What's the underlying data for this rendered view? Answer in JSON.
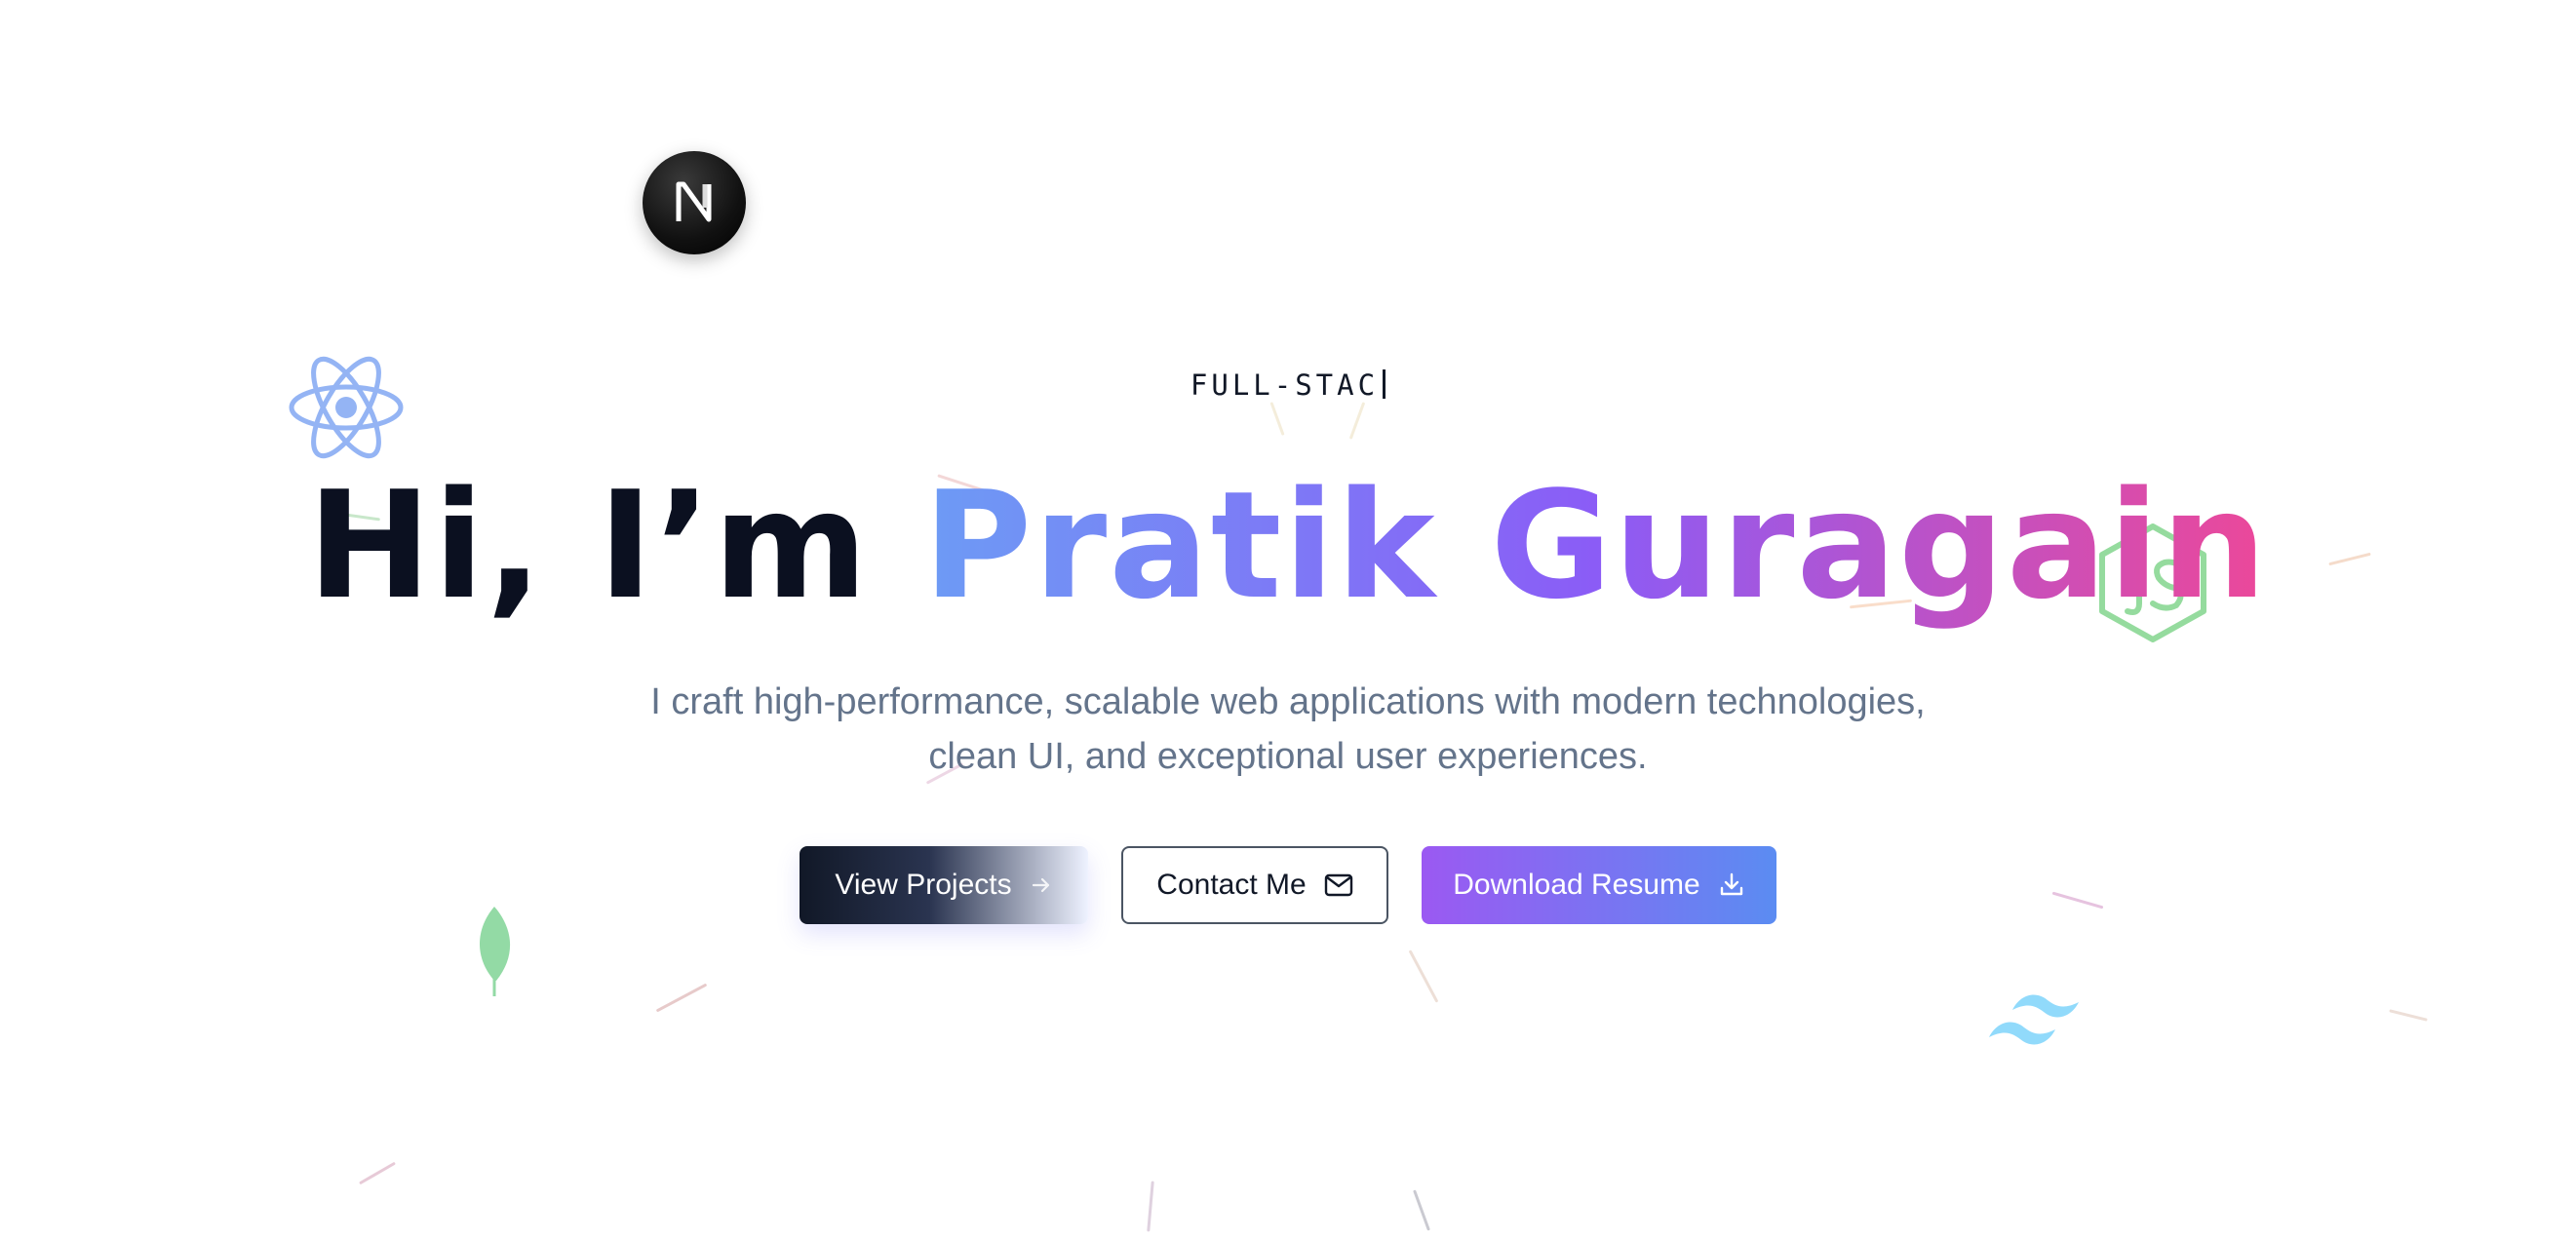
{
  "hero": {
    "typing_text": "FULL-STAC",
    "greeting": "Hi, I’m",
    "name": "Pratik Guragain",
    "subtitle_line1": "I craft high-performance, scalable web applications with modern technologies,",
    "subtitle_line2": "clean UI, and exceptional user experiences."
  },
  "buttons": {
    "view_projects": "View Projects",
    "contact_me": "Contact Me",
    "download_resume": "Download Resume"
  },
  "icons": {
    "floating": [
      "nextjs-icon",
      "react-icon",
      "nodejs-icon",
      "mongodb-icon",
      "tailwind-icon"
    ],
    "view_projects": "arrow-right-icon",
    "contact_me": "mail-icon",
    "download_resume": "download-icon"
  },
  "colors": {
    "name_gradient_start": "#6d9bf5",
    "name_gradient_mid": "#8b5cf6",
    "name_gradient_end": "#ec4899",
    "resume_button_start": "#9b59f2",
    "resume_button_end": "#5b8cf2",
    "primary_dark": "#111827"
  }
}
